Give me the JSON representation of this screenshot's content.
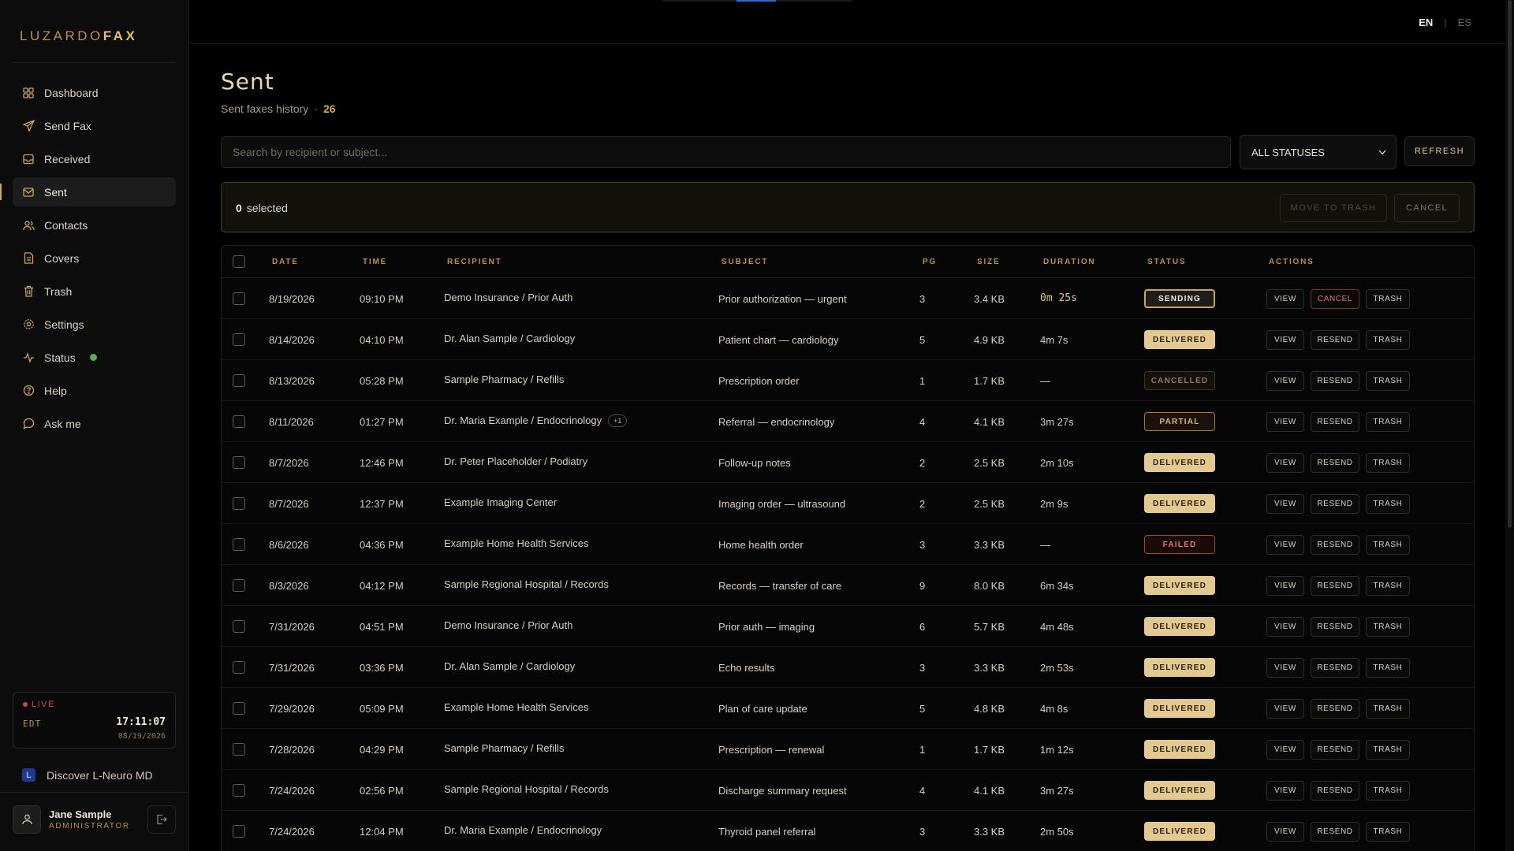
{
  "app": {
    "logo_part1": "LUZARDO",
    "logo_part2": "FAX"
  },
  "sidebar": {
    "items": [
      {
        "label": "Dashboard",
        "icon": "dashboard-icon"
      },
      {
        "label": "Send Fax",
        "icon": "send-icon"
      },
      {
        "label": "Received",
        "icon": "inbox-icon"
      },
      {
        "label": "Sent",
        "icon": "sent-mail-icon",
        "active": true
      },
      {
        "label": "Contacts",
        "icon": "contacts-icon"
      },
      {
        "label": "Covers",
        "icon": "document-icon"
      },
      {
        "label": "Trash",
        "icon": "trash-icon"
      },
      {
        "label": "Settings",
        "icon": "gear-icon"
      },
      {
        "label": "Status",
        "icon": "activity-icon",
        "status_color": "#57b03f"
      },
      {
        "label": "Help",
        "icon": "help-icon"
      },
      {
        "label": "Ask me",
        "icon": "chat-icon"
      }
    ],
    "clock": {
      "live_label": "LIVE",
      "timezone": "EDT",
      "time": "17:11:07",
      "date": "08/19/2026"
    },
    "discover_label": "Discover L-Neuro MD",
    "user": {
      "name": "Jane Sample",
      "role": "ADMINISTRATOR"
    }
  },
  "header": {
    "lang_active": "EN",
    "lang_separator": "|",
    "lang_other": "ES"
  },
  "page": {
    "title": "Sent",
    "subtitle": "Sent faxes history",
    "subtitle_separator": "·",
    "total_count": "26"
  },
  "filters": {
    "search_placeholder": "Search by recipient or subject...",
    "status_value": "ALL STATUSES",
    "refresh_label": "REFRESH"
  },
  "selection": {
    "count": "0",
    "label": "selected",
    "move_label": "MOVE TO TRASH",
    "cancel_label": "CANCEL"
  },
  "table": {
    "columns": [
      "DATE",
      "TIME",
      "RECIPIENT",
      "SUBJECT",
      "PG",
      "SIZE",
      "DURATION",
      "STATUS",
      "ACTIONS"
    ],
    "rows": [
      {
        "date": "8/19/2026",
        "time": "09:10 PM",
        "recipient": "Demo Insurance / Prior Auth",
        "chip": "",
        "subject": "Prior authorization — urgent",
        "pg": "3",
        "size": "3.4 KB",
        "duration": "0m 25s",
        "status": "SENDING",
        "kind": "sending",
        "actions": [
          "VIEW",
          "CANCEL",
          "TRASH"
        ]
      },
      {
        "date": "8/14/2026",
        "time": "04:10 PM",
        "recipient": "Dr. Alan Sample / Cardiology",
        "chip": "",
        "subject": "Patient chart — cardiology",
        "pg": "5",
        "size": "4.9 KB",
        "duration": "4m 7s",
        "status": "DELIVERED",
        "kind": "delivered",
        "actions": [
          "VIEW",
          "RESEND",
          "TRASH"
        ]
      },
      {
        "date": "8/13/2026",
        "time": "05:28 PM",
        "recipient": "Sample Pharmacy / Refills",
        "chip": "",
        "subject": "Prescription order",
        "pg": "1",
        "size": "1.7 KB",
        "duration": "—",
        "status": "CANCELLED",
        "kind": "cancelled",
        "actions": [
          "VIEW",
          "RESEND",
          "TRASH"
        ]
      },
      {
        "date": "8/11/2026",
        "time": "01:27 PM",
        "recipient": "Dr. Maria Example / Endocrinology",
        "chip": "+1",
        "subject": "Referral — endocrinology",
        "pg": "4",
        "size": "4.1 KB",
        "duration": "3m 27s",
        "status": "PARTIAL",
        "kind": "partial",
        "actions": [
          "VIEW",
          "RESEND",
          "TRASH"
        ]
      },
      {
        "date": "8/7/2026",
        "time": "12:46 PM",
        "recipient": "Dr. Peter Placeholder / Podiatry",
        "chip": "",
        "subject": "Follow-up notes",
        "pg": "2",
        "size": "2.5 KB",
        "duration": "2m 10s",
        "status": "DELIVERED",
        "kind": "delivered",
        "actions": [
          "VIEW",
          "RESEND",
          "TRASH"
        ]
      },
      {
        "date": "8/7/2026",
        "time": "12:37 PM",
        "recipient": "Example Imaging Center",
        "chip": "",
        "subject": "Imaging order — ultrasound",
        "pg": "2",
        "size": "2.5 KB",
        "duration": "2m 9s",
        "status": "DELIVERED",
        "kind": "delivered",
        "actions": [
          "VIEW",
          "RESEND",
          "TRASH"
        ]
      },
      {
        "date": "8/6/2026",
        "time": "04:36 PM",
        "recipient": "Example Home Health Services",
        "chip": "",
        "subject": "Home health order",
        "pg": "3",
        "size": "3.3 KB",
        "duration": "—",
        "status": "FAILED",
        "kind": "failed",
        "actions": [
          "VIEW",
          "RESEND",
          "TRASH"
        ]
      },
      {
        "date": "8/3/2026",
        "time": "04:12 PM",
        "recipient": "Sample Regional Hospital / Records",
        "chip": "",
        "subject": "Records — transfer of care",
        "pg": "9",
        "size": "8.0 KB",
        "duration": "6m 34s",
        "status": "DELIVERED",
        "kind": "delivered",
        "actions": [
          "VIEW",
          "RESEND",
          "TRASH"
        ]
      },
      {
        "date": "7/31/2026",
        "time": "04:51 PM",
        "recipient": "Demo Insurance / Prior Auth",
        "chip": "",
        "subject": "Prior auth — imaging",
        "pg": "6",
        "size": "5.7 KB",
        "duration": "4m 48s",
        "status": "DELIVERED",
        "kind": "delivered",
        "actions": [
          "VIEW",
          "RESEND",
          "TRASH"
        ]
      },
      {
        "date": "7/31/2026",
        "time": "03:36 PM",
        "recipient": "Dr. Alan Sample / Cardiology",
        "chip": "",
        "subject": "Echo results",
        "pg": "3",
        "size": "3.3 KB",
        "duration": "2m 53s",
        "status": "DELIVERED",
        "kind": "delivered",
        "actions": [
          "VIEW",
          "RESEND",
          "TRASH"
        ]
      },
      {
        "date": "7/29/2026",
        "time": "05:09 PM",
        "recipient": "Example Home Health Services",
        "chip": "",
        "subject": "Plan of care update",
        "pg": "5",
        "size": "4.8 KB",
        "duration": "4m 8s",
        "status": "DELIVERED",
        "kind": "delivered",
        "actions": [
          "VIEW",
          "RESEND",
          "TRASH"
        ]
      },
      {
        "date": "7/28/2026",
        "time": "04:29 PM",
        "recipient": "Sample Pharmacy / Refills",
        "chip": "",
        "subject": "Prescription — renewal",
        "pg": "1",
        "size": "1.7 KB",
        "duration": "1m 12s",
        "status": "DELIVERED",
        "kind": "delivered",
        "actions": [
          "VIEW",
          "RESEND",
          "TRASH"
        ]
      },
      {
        "date": "7/24/2026",
        "time": "02:56 PM",
        "recipient": "Sample Regional Hospital / Records",
        "chip": "",
        "subject": "Discharge summary request",
        "pg": "4",
        "size": "4.1 KB",
        "duration": "3m 27s",
        "status": "DELIVERED",
        "kind": "delivered",
        "actions": [
          "VIEW",
          "RESEND",
          "TRASH"
        ]
      },
      {
        "date": "7/24/2026",
        "time": "12:04 PM",
        "recipient": "Dr. Maria Example / Endocrinology",
        "chip": "",
        "subject": "Thyroid panel referral",
        "pg": "3",
        "size": "3.3 KB",
        "duration": "2m 50s",
        "status": "DELIVERED",
        "kind": "delivered",
        "actions": [
          "VIEW",
          "RESEND",
          "TRASH"
        ]
      }
    ]
  },
  "colors": {
    "accent_gold": "#d4a94e",
    "delivered_badge": "#e3c98f",
    "failed": "#e07a6e",
    "status_online": "#57b03f"
  }
}
